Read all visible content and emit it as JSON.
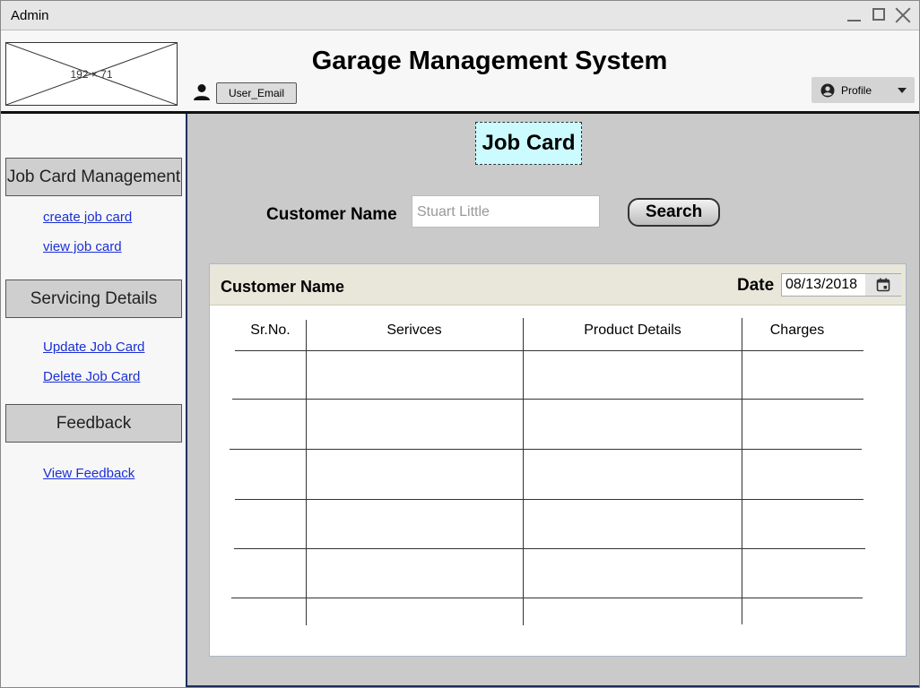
{
  "window": {
    "title": "Admin"
  },
  "header": {
    "logo_placeholder": "192 × 71",
    "app_title": "Garage Management System",
    "user_email": "User_Email",
    "profile_label": "Profile"
  },
  "sidebar": {
    "sections": [
      {
        "label": "Job Card Management",
        "links": [
          "create job card",
          "view job card"
        ]
      },
      {
        "label": "Servicing Details",
        "links": [
          "Update Job Card",
          "Delete Job Card"
        ]
      },
      {
        "label": "Feedback",
        "links": [
          "View Feedback"
        ]
      }
    ]
  },
  "main": {
    "title": "Job Card",
    "customer_label": "Customer Name",
    "customer_value": "Stuart Little",
    "search_label": "Search",
    "card": {
      "title": "Customer Name",
      "date_label": "Date",
      "date_value": "08/13/2018",
      "columns": [
        "Sr.No.",
        "Serivces",
        "Product Details",
        "Charges"
      ],
      "rows": [
        [
          "",
          "",
          "",
          ""
        ],
        [
          "",
          "",
          "",
          ""
        ],
        [
          "",
          "",
          "",
          ""
        ],
        [
          "",
          "",
          "",
          ""
        ],
        [
          "",
          "",
          "",
          ""
        ]
      ]
    }
  },
  "icons": {
    "user": "person-icon",
    "profile": "account-circle-icon",
    "calendar": "calendar-icon"
  }
}
